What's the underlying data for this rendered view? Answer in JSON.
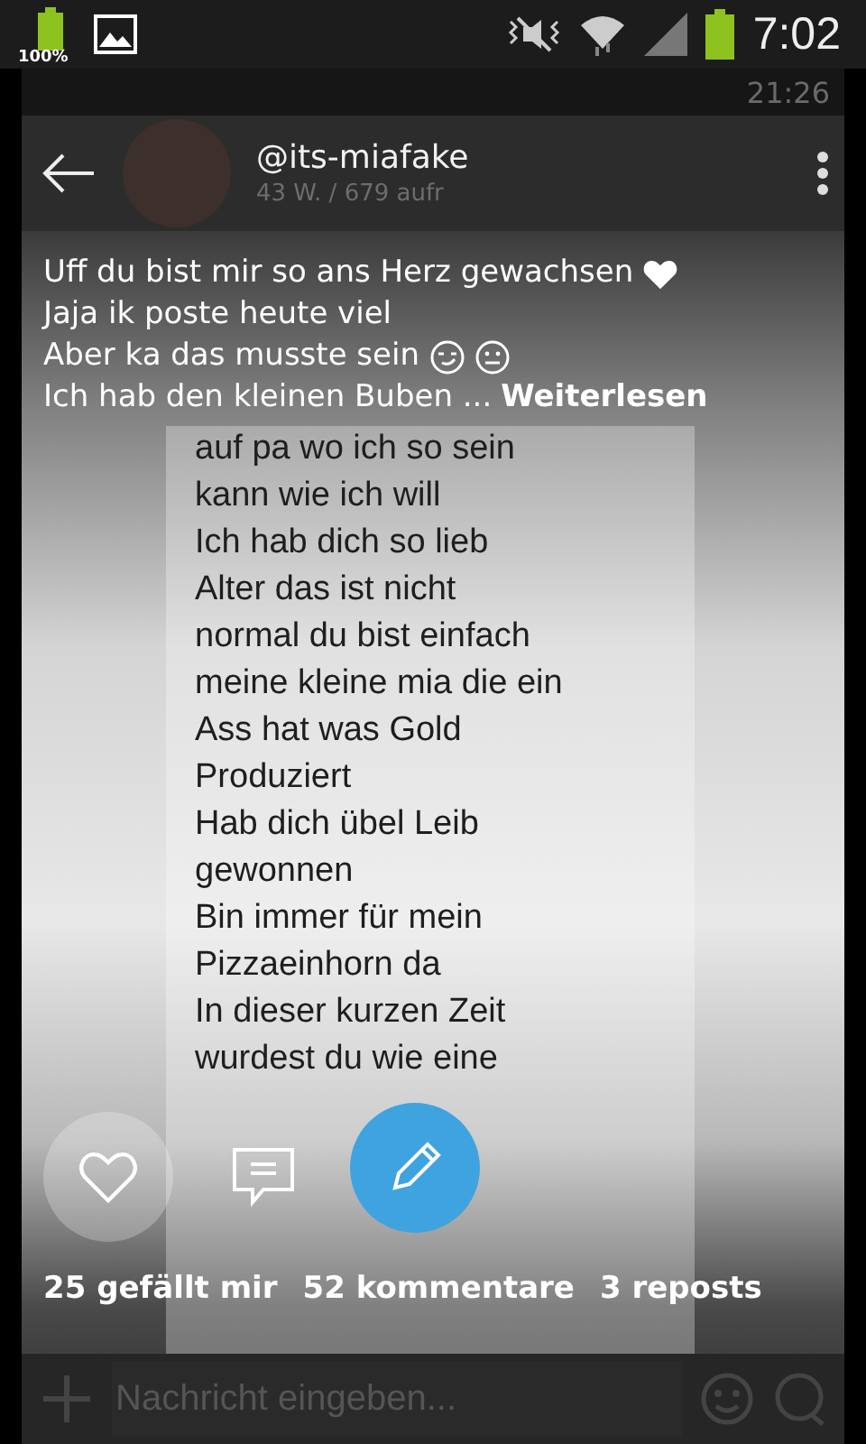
{
  "status_bar": {
    "battery_label": "100%",
    "time": "7:02"
  },
  "inner_status_bar": {
    "time": "21:26"
  },
  "header": {
    "username": "@its-miafake",
    "subtitle": "43 W. / 679 aufr"
  },
  "caption": {
    "lines": [
      {
        "text": "Uff du bist mir so ans Herz gewachsen",
        "emoji": [
          {
            "kind": "heart"
          }
        ]
      },
      {
        "text": "Jaja ik poste heute viel"
      },
      {
        "text": "Aber ka das musste sein",
        "emoji": [
          {
            "kind": "smirk"
          },
          {
            "kind": "neutral"
          }
        ]
      }
    ],
    "last_line": "Ich hab den kleinen Buben ...",
    "more_link": "Weiterlesen"
  },
  "chat_bubble": {
    "lines": [
      "auf pa wo ich so sein",
      "kann wie ich will",
      "Ich hab dich so lieb",
      "Alter das ist nicht",
      "normal du bist einfach",
      "meine kleine mia die ein",
      "Ass hat was Gold",
      "Produziert",
      "Hab dich übel Leib",
      "gewonnen",
      "Bin immer für mein",
      "Pizzaeinhorn da",
      "In dieser kurzen Zeit",
      "wurdest du wie eine"
    ]
  },
  "stats": {
    "likes": "25 gefällt mir",
    "comments": "52 kommentare",
    "reposts": "3 reposts"
  },
  "composer": {
    "placeholder": "Nachricht eingeben..."
  }
}
